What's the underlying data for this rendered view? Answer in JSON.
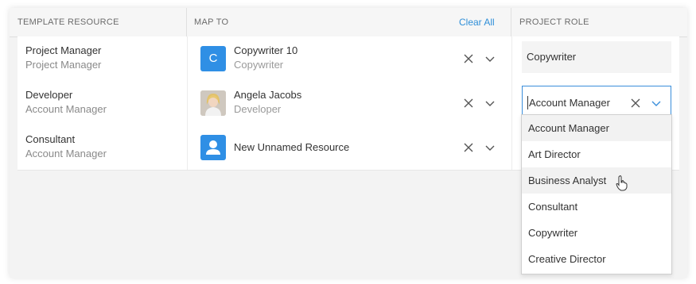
{
  "header": {
    "template_resource": "TEMPLATE RESOURCE",
    "map_to": "MAP TO",
    "clear_all": "Clear All",
    "project_role": "PROJECT ROLE"
  },
  "rows": [
    {
      "template_name": "Project Manager",
      "template_role": "Project Manager",
      "avatar": "C",
      "resource_name": "Copywriter 10",
      "resource_sub": "Copywriter",
      "project_role": "Copywriter"
    },
    {
      "template_name": "Developer",
      "template_role": "Account Manager",
      "avatar": "photo",
      "resource_name": "Angela Jacobs",
      "resource_sub": "Developer",
      "project_role": "Account Manager"
    },
    {
      "template_name": "Consultant",
      "template_role": "Account Manager",
      "avatar": "person-icon",
      "resource_name": "New Unnamed Resource",
      "resource_sub": "",
      "project_role": ""
    }
  ],
  "dropdown": {
    "options": [
      "Account Manager",
      "Art Director",
      "Business Analyst",
      "Consultant",
      "Copywriter",
      "Creative Director"
    ],
    "highlighted": [
      "Account Manager",
      "Business Analyst"
    ]
  },
  "colors": {
    "accent": "#2f8fd8",
    "avatar_bg": "#2f8fe5",
    "focus_border": "#3a8edb"
  }
}
